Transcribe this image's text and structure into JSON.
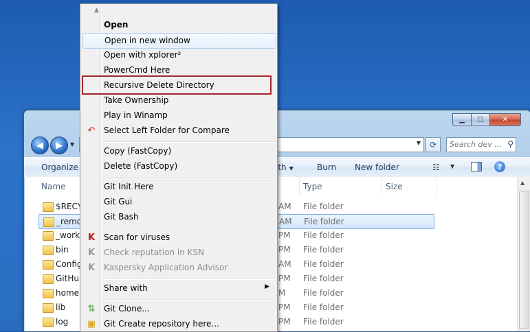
{
  "window": {
    "search_placeholder": "Search dev ...",
    "toolbar": {
      "organize": "Organize",
      "share_with_partial": "ith",
      "burn": "Burn",
      "new_folder": "New folder"
    },
    "columns": {
      "name": "Name",
      "type": "Type",
      "size": "Size"
    },
    "files": [
      {
        "name": "$RECYC",
        "date": "AM",
        "type": "File folder"
      },
      {
        "name": "_remov",
        "date": "AM",
        "type": "File folder",
        "selected": true
      },
      {
        "name": "_work",
        "date": "PM",
        "type": "File folder"
      },
      {
        "name": "bin",
        "date": "PM",
        "type": "File folder"
      },
      {
        "name": "Config",
        "date": "AM",
        "type": "File folder"
      },
      {
        "name": "GitHub",
        "date": "PM",
        "type": "File folder"
      },
      {
        "name": "home",
        "date": "M",
        "type": "File folder"
      },
      {
        "name": "lib",
        "date": "PM",
        "type": "File folder"
      },
      {
        "name": "log",
        "date": "PM",
        "type": "File folder"
      }
    ]
  },
  "menu": {
    "items": [
      {
        "label": "Open",
        "bold": true
      },
      {
        "label": "Open in new window",
        "hover": true
      },
      {
        "label": "Open with xplorer²"
      },
      {
        "label": "PowerCmd Here"
      },
      {
        "label": "Recursive Delete Directory"
      },
      {
        "label": "Take Ownership"
      },
      {
        "label": "Play in Winamp"
      },
      {
        "label": "Select Left Folder for Compare",
        "icon": "undo-arrow-icon"
      },
      {
        "label": "Copy  (FastCopy)"
      },
      {
        "label": "Delete (FastCopy)"
      },
      {
        "label": "Git Init Here"
      },
      {
        "label": "Git Gui"
      },
      {
        "label": "Git Bash"
      },
      {
        "label": "Scan for viruses",
        "icon": "kaspersky-icon"
      },
      {
        "label": "Check reputation in KSN",
        "disabled": true,
        "icon": "kaspersky-icon"
      },
      {
        "label": "Kaspersky Application Advisor",
        "disabled": true,
        "icon": "kaspersky-icon"
      },
      {
        "label": "Share with",
        "submenu": true
      },
      {
        "label": "Git Clone...",
        "icon": "git-clone-icon"
      },
      {
        "label": "Git Create repository here...",
        "icon": "git-create-icon"
      }
    ]
  },
  "colors": {
    "highlight_box": "#a3262c",
    "menu_hover": "#e5effb",
    "selection": "#d3e7fb"
  }
}
